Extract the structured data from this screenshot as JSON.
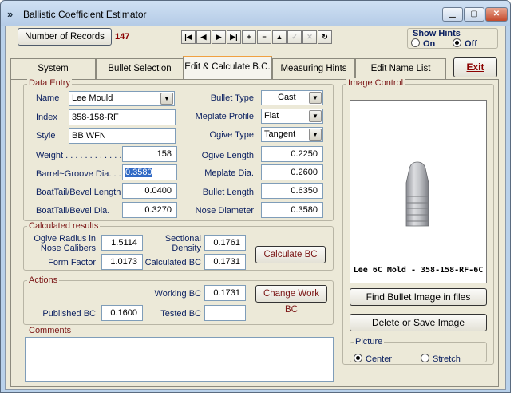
{
  "window": {
    "title": "Ballistic Coefficient Estimator"
  },
  "toolbar": {
    "records_button": "Number of Records",
    "records_count": "147",
    "nav_buttons": [
      {
        "name": "first-record-icon",
        "glyph": "|◀"
      },
      {
        "name": "prev-record-icon",
        "glyph": "◀"
      },
      {
        "name": "next-record-icon",
        "glyph": "▶"
      },
      {
        "name": "last-record-icon",
        "glyph": "▶|"
      },
      {
        "name": "add-record-icon",
        "glyph": "+"
      },
      {
        "name": "delete-record-icon",
        "glyph": "−"
      },
      {
        "name": "edit-record-icon",
        "glyph": "▲"
      },
      {
        "name": "post-record-icon",
        "glyph": "✓"
      },
      {
        "name": "cancel-record-icon",
        "glyph": "✕"
      },
      {
        "name": "refresh-record-icon",
        "glyph": "↻"
      }
    ],
    "hints": {
      "title": "Show Hints",
      "on": "On",
      "off": "Off",
      "selected": "Off"
    }
  },
  "tabs": [
    {
      "label": "System"
    },
    {
      "label": "Bullet Selection"
    },
    {
      "label": "Edit & Calculate B.C."
    },
    {
      "label": "Measuring Hints"
    },
    {
      "label": "Edit Name List"
    }
  ],
  "active_tab": "Edit & Calculate B.C.",
  "exit_label": "Exit",
  "data_entry": {
    "title": "Data Entry",
    "name_label": "Name",
    "name_value": "Lee Mould",
    "index_label": "Index",
    "index_value": "358-158-RF",
    "style_label": "Style",
    "style_value": "BB WFN",
    "weight_label": "Weight . . . . . . . . . . . .",
    "weight_value": "158",
    "barrel_label": "Barrel~Groove Dia. . .",
    "barrel_value": "0.3580",
    "boattail_len_label": "BoatTail/Bevel Length",
    "boattail_len_value": "0.0400",
    "boattail_dia_label": "BoatTail/Bevel Dia.",
    "boattail_dia_value": "0.3270",
    "bullet_type_label": "Bullet Type",
    "bullet_type_value": "Cast",
    "meplate_profile_label": "Meplate Profile",
    "meplate_profile_value": "Flat",
    "ogive_type_label": "Ogive Type",
    "ogive_type_value": "Tangent",
    "ogive_length_label": "Ogive Length",
    "ogive_length_value": "0.2250",
    "meplate_dia_label": "Meplate Dia.",
    "meplate_dia_value": "0.2600",
    "bullet_length_label": "Bullet Length",
    "bullet_length_value": "0.6350",
    "nose_dia_label": "Nose Diameter",
    "nose_dia_value": "0.3580"
  },
  "calculated": {
    "title": "Calculated results",
    "ogive_radius_label": "Ogive Radius in Nose Calibers",
    "ogive_radius_value": "1.5114",
    "form_factor_label": "Form Factor",
    "form_factor_value": "1.0173",
    "sectional_density_label": "Sectional Density",
    "sectional_density_value": "0.1761",
    "calculated_bc_label": "Calculated BC",
    "calculated_bc_value": "0.1731",
    "calculate_button": "Calculate BC"
  },
  "actions": {
    "title": "Actions",
    "working_bc_label": "Working BC",
    "working_bc_value": "0.1731",
    "change_button": "Change Work BC",
    "published_bc_label": "Published BC",
    "published_bc_value": "0.1600",
    "tested_bc_label": "Tested BC",
    "tested_bc_value": ""
  },
  "comments": {
    "title": "Comments",
    "value": ""
  },
  "image_control": {
    "title": "Image Control",
    "caption": "Lee 6C Mold - 358-158-RF-6C",
    "find_button": "Find Bullet Image in files",
    "delete_button": "Delete or Save Image",
    "picture_title": "Picture",
    "center": "Center",
    "stretch": "Stretch",
    "selected": "Center"
  }
}
